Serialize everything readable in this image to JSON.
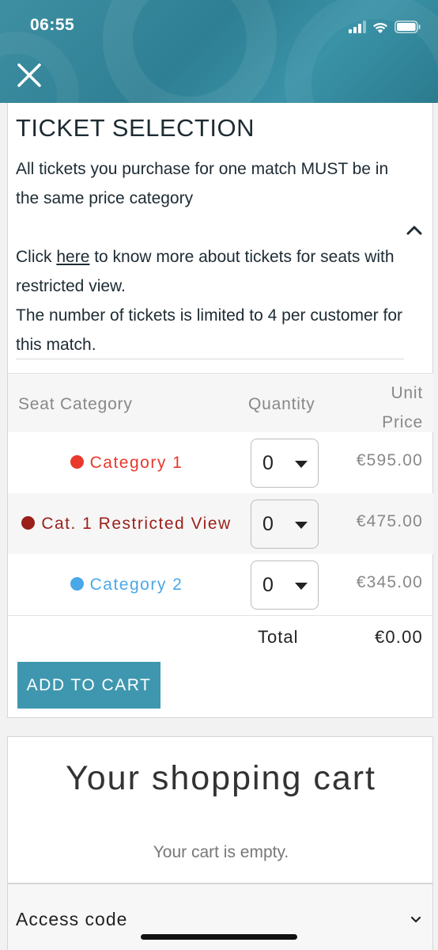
{
  "status_bar": {
    "time": "06:55"
  },
  "header": {
    "close_icon": "close-icon",
    "accent": "#3f8fa3"
  },
  "ticket_selection": {
    "title": "TICKET SELECTION",
    "info_line1": "All tickets you purchase for one match MUST be in the same price category",
    "info_click_prefix": "Click ",
    "info_click_link": "here",
    "info_click_suffix": " to know more about tickets for seats with restricted view.",
    "info_limit": "The number of tickets is limited to 4 per customer for this match.",
    "table": {
      "headers": {
        "category": "Seat Category",
        "quantity": "Quantity",
        "price_line1": "Unit",
        "price_line2": "Price"
      },
      "rows": [
        {
          "category": "Category 1",
          "dot_color": "#e8392b",
          "text_color": "#e8392b",
          "quantity": "0",
          "price": "€595.00"
        },
        {
          "category": "Cat. 1 Restricted View",
          "dot_color": "#9a1f1a",
          "text_color": "#9a1f1a",
          "quantity": "0",
          "price": "€475.00"
        },
        {
          "category": "Category 2",
          "dot_color": "#4aa8e8",
          "text_color": "#4aa8e8",
          "quantity": "0",
          "price": "€345.00"
        }
      ],
      "total_label": "Total",
      "total_value": "€0.00"
    },
    "add_to_cart": "ADD TO CART",
    "button_color": "#3f97af"
  },
  "cart": {
    "title": "Your shopping cart",
    "empty_message": "Your cart is empty."
  },
  "access_code": {
    "label": "Access code"
  }
}
